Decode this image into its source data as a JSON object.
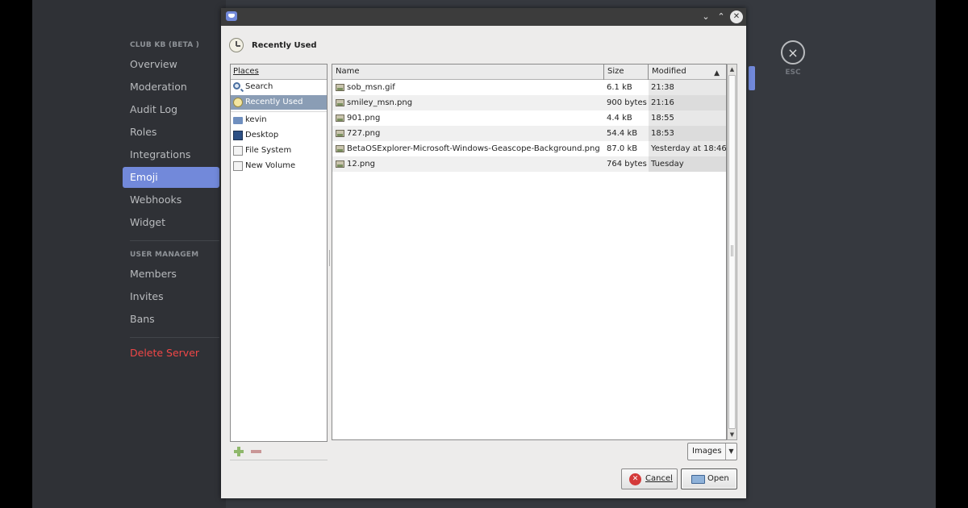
{
  "discord": {
    "server_section": "CLUB KB (BETA )",
    "items": [
      "Overview",
      "Moderation",
      "Audit Log",
      "Roles",
      "Integrations",
      "Emoji",
      "Webhooks",
      "Widget"
    ],
    "user_section": "USER MANAGEM",
    "user_items": [
      "Members",
      "Invites",
      "Bans"
    ],
    "delete_label": "Delete Server",
    "esc_label": "ESC",
    "esc_icon": "×",
    "accent_color": "#7289da",
    "danger_color": "#f04747"
  },
  "dialog": {
    "titlebar": {
      "minimize_icon": "⌄",
      "maximize_icon": "⌃",
      "close_icon": "✕"
    },
    "location_title": "Recently Used",
    "places": {
      "header": "Places",
      "items": [
        {
          "label": "Search",
          "icon": "search-icon"
        },
        {
          "label": "Recently Used",
          "icon": "recent-icon"
        },
        {
          "label": "kevin",
          "icon": "home-folder-icon"
        },
        {
          "label": "Desktop",
          "icon": "desktop-icon"
        },
        {
          "label": "File System",
          "icon": "filesystem-icon"
        },
        {
          "label": "New Volume",
          "icon": "volume-icon"
        }
      ],
      "selected": "Recently Used"
    },
    "files": {
      "columns": [
        "Name",
        "Size",
        "Modified"
      ],
      "sort_arrow": "▲",
      "rows": [
        {
          "name": "sob_msn.gif",
          "size": "6.1 kB",
          "modified": "21:38"
        },
        {
          "name": "smiley_msn.png",
          "size": "900 bytes",
          "modified": "21:16"
        },
        {
          "name": "901.png",
          "size": "4.4 kB",
          "modified": "18:55"
        },
        {
          "name": "727.png",
          "size": "54.4 kB",
          "modified": "18:53"
        },
        {
          "name": "BetaOSExplorer-Microsoft-Windows-Geascope-Background.png",
          "size": "87.0 kB",
          "modified": "Yesterday at 18:46"
        },
        {
          "name": "12.png",
          "size": "764 bytes",
          "modified": "Tuesday"
        }
      ]
    },
    "scroll": {
      "up": "▲",
      "down": "▼"
    },
    "filter": {
      "value": "Images",
      "arrow": "▼"
    },
    "buttons": {
      "cancel": "Cancel",
      "cancel_icon": "✕",
      "open": "Open"
    },
    "colors": {
      "selection": "#8a9db5",
      "cancel_icon": "#d43a3a"
    }
  }
}
